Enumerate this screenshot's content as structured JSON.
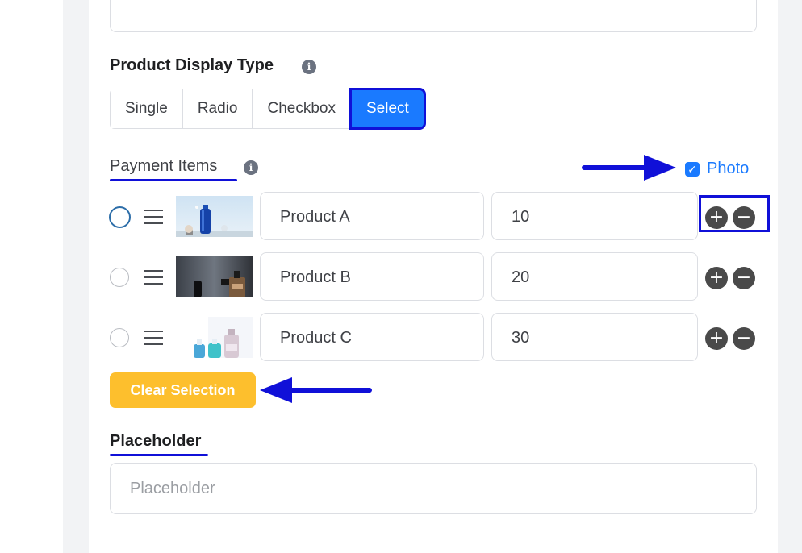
{
  "display_type": {
    "label": "Product Display Type",
    "info_icon": "i",
    "options": [
      "Single",
      "Radio",
      "Checkbox",
      "Select"
    ],
    "selected": "Select"
  },
  "payment_items": {
    "label": "Payment Items",
    "info_icon": "i",
    "photo_checkbox": {
      "label": "Photo",
      "checked": true,
      "check_glyph": "✓"
    },
    "items": [
      {
        "name": "Product A",
        "price": "10",
        "image": "blue-bottle-photo",
        "selected_radio": true
      },
      {
        "name": "Product B",
        "price": "20",
        "image": "dark-bottles-photo",
        "selected_radio": false
      },
      {
        "name": "Product C",
        "price": "30",
        "image": "perfume-bottles-photo",
        "selected_radio": false
      }
    ],
    "add_glyph": "+",
    "remove_glyph": "−"
  },
  "clear_selection_label": "Clear Selection",
  "placeholder_field": {
    "label": "Placeholder",
    "placeholder": "Placeholder"
  },
  "colors": {
    "accent": "#1a7aff",
    "annotation": "#1010d8",
    "clear_button": "#fdbf2d"
  }
}
